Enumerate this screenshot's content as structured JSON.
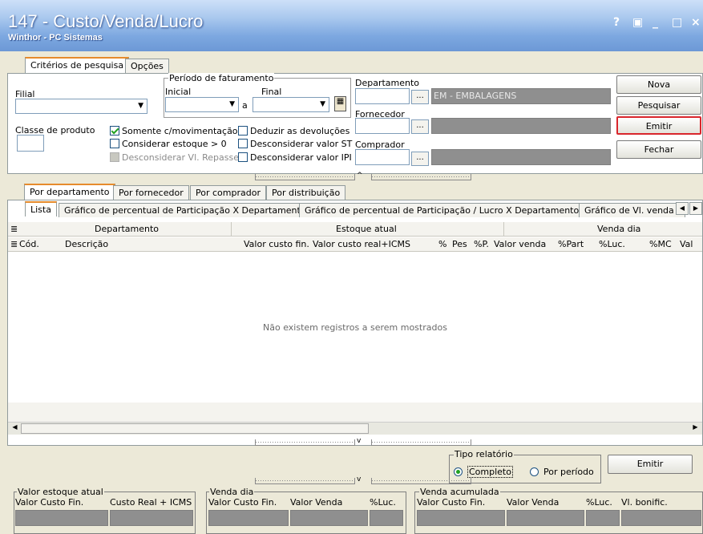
{
  "window": {
    "title": "147 - Custo/Venda/Lucro",
    "subtitle": "Winthor - PC Sistemas",
    "help": "?",
    "restore": "▣",
    "minimize": "_",
    "maximize": "□",
    "close": "×"
  },
  "tabs_top": [
    "Critérios de pesquisa",
    "Opções"
  ],
  "filters": {
    "filial_label": "Filial",
    "periodo_label": "Período de faturamento",
    "inicial_label": "Inicial",
    "final_label": "Final",
    "a_label": "a",
    "departamento_label": "Departamento",
    "departamento_value": "EM - EMBALAGENS",
    "fornecedor_label": "Fornecedor",
    "comprador_label": "Comprador",
    "classe_label": "Classe de produto",
    "chk_somente": "Somente c/movimentação",
    "chk_considerar": "Considerar estoque > 0",
    "chk_desconsiderar_repasse": "Desconsiderar Vl. Repasse",
    "chk_deduzir": "Deduzir as devoluções",
    "chk_desc_st": "Desconsiderar valor ST",
    "chk_desc_ipi": "Desconsiderar valor IPI",
    "ellipsis": "..."
  },
  "buttons": {
    "nova": "Nova",
    "pesquisar": "Pesquisar",
    "emitir": "Emitir",
    "fechar": "Fechar",
    "emitir2": "Emitir"
  },
  "tabs_mid": [
    "Por departamento",
    "Por fornecedor",
    "Por comprador",
    "Por distribuição"
  ],
  "tabs_view": [
    "Lista",
    "Gráfico de percentual de Participação X Departamento",
    "Gráfico de percentual de Participação / Lucro X Departamento",
    "Gráfico de Vl. venda ,"
  ],
  "grid": {
    "group_headers": [
      "Departamento",
      "Estoque atual",
      "Venda dia"
    ],
    "columns": [
      "Cód.",
      "Descrição",
      "Valor custo fin.",
      "Valor custo real+ICMS",
      "%",
      "Pes",
      "%P.",
      "Valor venda",
      "%Part",
      "%Luc.",
      "%MC",
      "Val"
    ],
    "empty_message": "Não existem registros a serem mostrados"
  },
  "tipo_relatorio": {
    "title": "Tipo relatório",
    "completo": "Completo",
    "por_periodo": "Por período"
  },
  "totals": {
    "estoque_title": "Valor estoque  atual",
    "estoque_cols": [
      "Valor Custo Fin.",
      "Custo Real + ICMS"
    ],
    "venda_dia_title": "Venda dia",
    "venda_dia_cols": [
      "Valor Custo Fin.",
      "Valor Venda",
      "%Luc."
    ],
    "venda_acum_title": "Venda acumulada",
    "venda_acum_cols": [
      "Valor Custo Fin.",
      "Valor Venda",
      "%Luc.",
      "Vl. bonific."
    ]
  },
  "colors": {
    "accent_tab": "#e68b2c",
    "emitir_border": "#d9262c",
    "title_text": "#ffffff"
  }
}
